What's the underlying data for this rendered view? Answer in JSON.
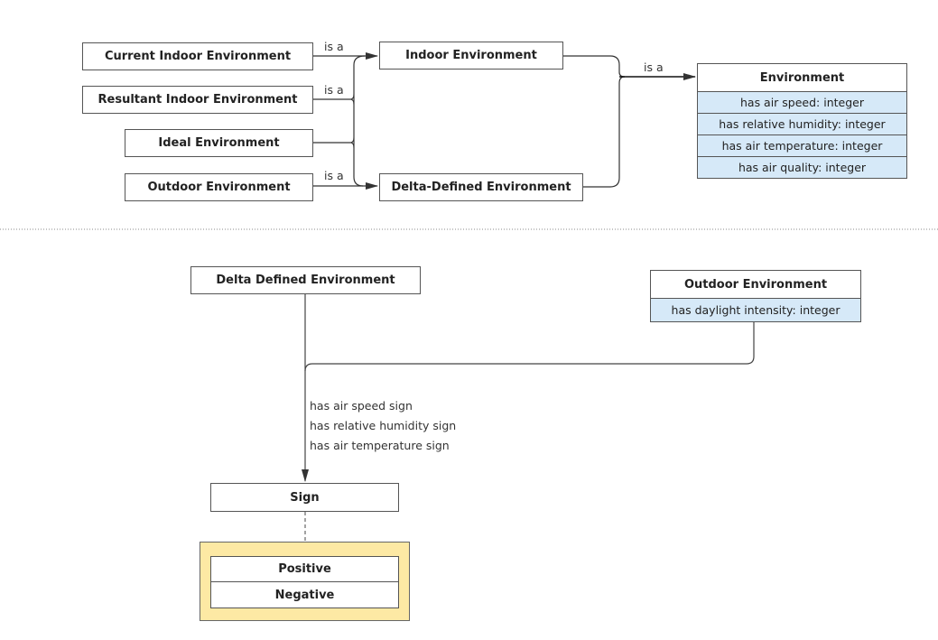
{
  "top_diagram": {
    "nodes": {
      "current_indoor": "Current Indoor Environment",
      "resultant_indoor": "Resultant Indoor Environment",
      "ideal": "Ideal Environment",
      "outdoor": "Outdoor Environment",
      "indoor": "Indoor Environment",
      "delta_defined": "Delta-Defined Environment"
    },
    "edge_labels": {
      "current_isa": "is a",
      "resultant_isa": "is a",
      "outdoor_isa": "is a",
      "environment_isa": "is a"
    },
    "environment_class": {
      "title": "Environment",
      "attributes": [
        "has air speed: integer",
        "has relative humidity: integer",
        "has air temperature: integer",
        "has air quality: integer"
      ]
    }
  },
  "bottom_diagram": {
    "delta_defined": "Delta Defined Environment",
    "outdoor_class": {
      "title": "Outdoor Environment",
      "attributes": [
        "has daylight intensity: integer"
      ]
    },
    "relation_labels": [
      "has air speed sign",
      "has relative humidity sign",
      "has air temperature sign"
    ],
    "sign": "Sign",
    "sign_values": [
      "Positive",
      "Negative"
    ]
  },
  "colors": {
    "attribute_fill": "#d6e9f8",
    "enum_fill": "#fde9a4",
    "line": "#333333"
  }
}
